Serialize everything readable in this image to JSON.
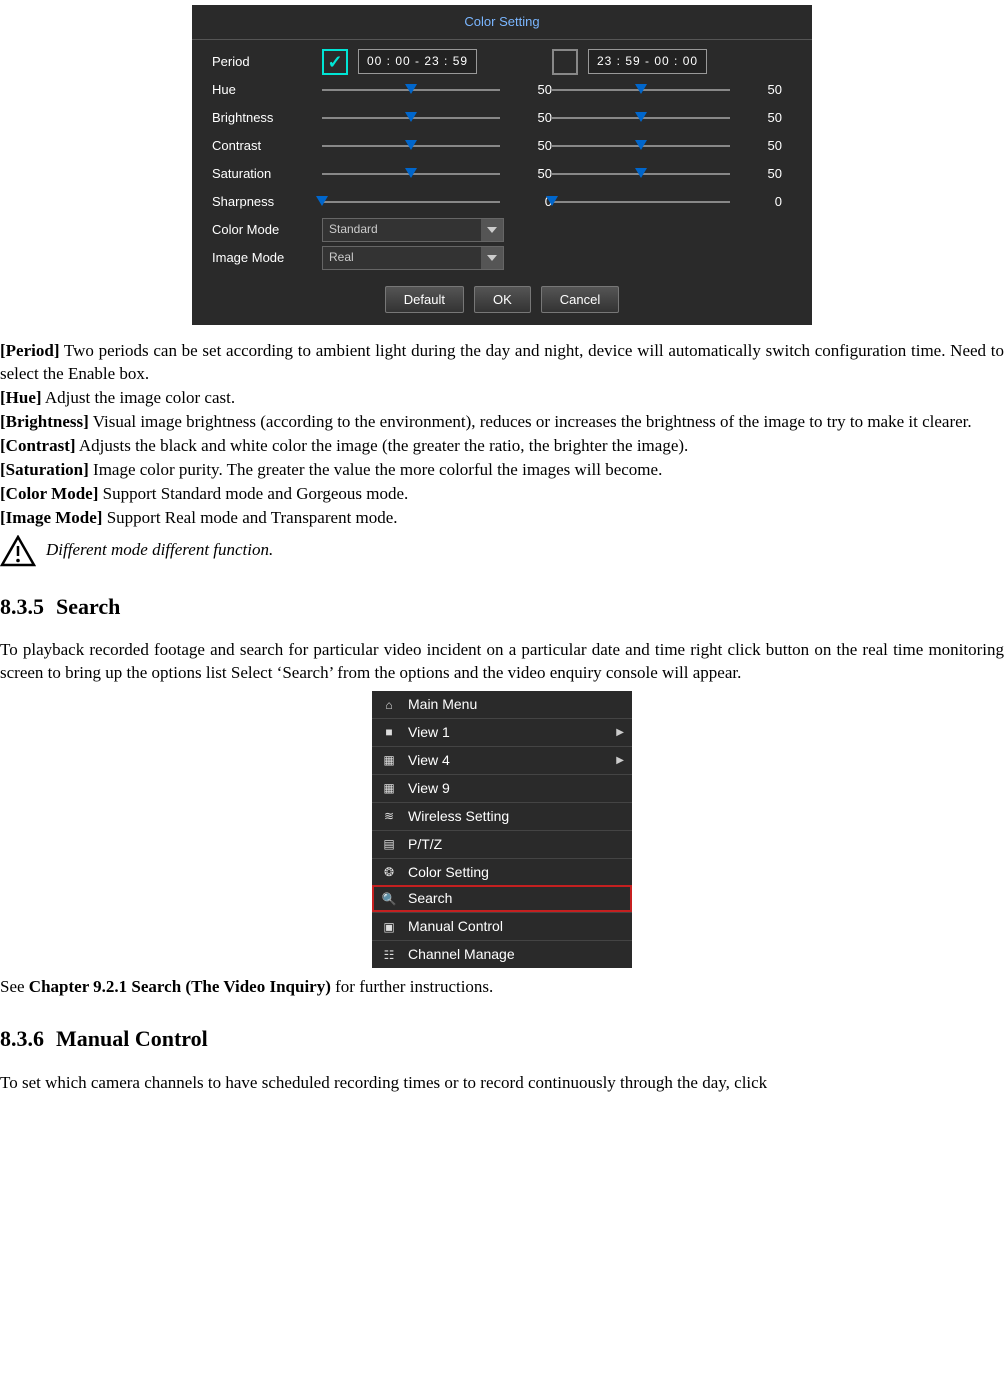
{
  "colorDialog": {
    "title": "Color Setting",
    "labels": {
      "period": "Period",
      "hue": "Hue",
      "brightness": "Brightness",
      "contrast": "Contrast",
      "saturation": "Saturation",
      "sharpness": "Sharpness",
      "colorMode": "Color Mode",
      "imageMode": "Image Mode"
    },
    "period1": {
      "enabled": true,
      "time": "00 : 00 - 23 : 59",
      "hue": 50,
      "brightness": 50,
      "contrast": 50,
      "saturation": 50,
      "sharpness": 0
    },
    "period2": {
      "enabled": false,
      "time": "23 : 59 - 00 : 00",
      "hue": 50,
      "brightness": 50,
      "contrast": 50,
      "saturation": 50,
      "sharpness": 0
    },
    "colorMode": "Standard",
    "imageMode": "Real",
    "buttons": {
      "default": "Default",
      "ok": "OK",
      "cancel": "Cancel"
    }
  },
  "definitions": {
    "period": {
      "term": "[Period]",
      "text": " Two periods can be set according to ambient light during the day and night, device will automatically switch configuration time. Need to select the Enable box."
    },
    "hue": {
      "term": "[Hue]",
      "text": " Adjust the image color cast."
    },
    "brightness": {
      "term": "[Brightness]",
      "text": " Visual image brightness (according to the environment), reduces or increases the brightness of the image to try to make it clearer."
    },
    "contrast": {
      "term": "[Contrast]",
      "text": " Adjusts the black and white color the image (the greater the ratio, the brighter the image)."
    },
    "saturation": {
      "term": "[Saturation]",
      "text": " Image color purity. The greater the value the more colorful the images will become."
    },
    "colorMode": {
      "term": "[Color Mode]",
      "text": " Support Standard mode and Gorgeous mode."
    },
    "imageMode": {
      "term": "[Image Mode]",
      "text": " Support Real mode and Transparent mode."
    }
  },
  "warning": "Different mode different function.",
  "sections": {
    "search": {
      "num": "8.3.5",
      "title": "Search"
    },
    "manual": {
      "num": "8.3.6",
      "title": "Manual Control"
    }
  },
  "searchPara": "To playback recorded footage and search for particular video incident on a particular date and time right click button on the real time monitoring screen to bring up the options list Select ‘Search’ from the options and the video enquiry console will appear.",
  "contextMenu": {
    "items": {
      "mainMenu": "Main Menu",
      "view1": "View 1",
      "view4": "View 4",
      "view9": "View 9",
      "wireless": "Wireless Setting",
      "ptz": "P/T/Z",
      "colorSetting": "Color Setting",
      "search": "Search",
      "manualControl": "Manual Control",
      "channelManage": "Channel Manage"
    }
  },
  "seeRef": {
    "prefix": "See ",
    "strong": "Chapter 9.2.1 Search (The Video Inquiry)",
    "suffix": " for further instructions."
  },
  "manualPara": "To set which camera channels to have scheduled recording times or to record continuously through the day, click"
}
